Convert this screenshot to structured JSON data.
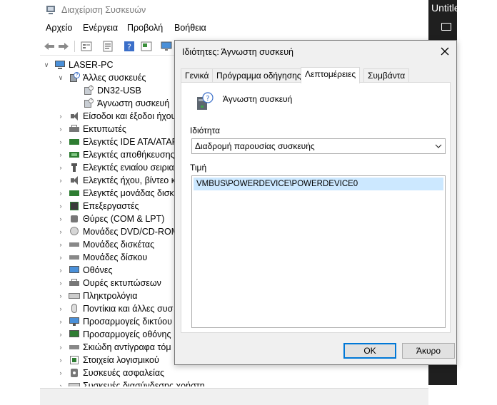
{
  "main_window": {
    "title": "Διαχείριση Συσκευών",
    "menu": [
      "Αρχείο",
      "Ενέργεια",
      "Προβολή",
      "Βοήθεια"
    ]
  },
  "tree": {
    "root": "LASER-PC",
    "other_devices": "Άλλες συσκευές",
    "dn32": "DN32-USB",
    "unknown": "Άγνωστη συσκευή",
    "items": [
      "Είσοδοι και έξοδοι ήχου",
      "Εκτυπωτές",
      "Ελεγκτές IDE ATA/ATAPI",
      "Ελεγκτές αποθήκευσης",
      "Ελεγκτές ενιαίου σειριακ",
      "Ελεγκτές ήχου, βίντεο κ",
      "Ελεγκτές μονάδας δισκ",
      "Επεξεργαστές",
      "Θύρες (COM & LPT)",
      "Μονάδες DVD/CD-ROM",
      "Μονάδες δισκέτας",
      "Μονάδες δίσκου",
      "Οθόνες",
      "Ουρές εκτυπώσεων",
      "Πληκτρολόγια",
      "Ποντίκια και άλλες συσ",
      "Προσαρμογείς δικτύου",
      "Προσαρμογείς οθόνης",
      "Σκιώδη αντίγραφα τόμ",
      "Στοιχεία λογισμικού",
      "Συσκευές ασφαλείας",
      "Συσκευές διασύνδεσης χρήστη"
    ]
  },
  "dark_window": {
    "title": "Untitle"
  },
  "dialog": {
    "title": "Ιδιότητες: Άγνωστη συσκευή",
    "tabs": [
      "Γενικά",
      "Πρόγραμμα οδήγησης",
      "Λεπτομέρειες",
      "Συμβάντα"
    ],
    "device_name": "Άγνωστη συσκευή",
    "property_label": "Ιδιότητα",
    "property_value": "Διαδρομή παρουσίας συσκευής",
    "value_label": "Τιμή",
    "value_item": "VMBUS\\POWERDEVICE\\POWERDEVICE0",
    "ok": "OK",
    "cancel": "Άκυρο"
  },
  "colors": {
    "accent": "#0078d7",
    "selection": "#cce8ff",
    "dark": "#1f1f1f"
  }
}
